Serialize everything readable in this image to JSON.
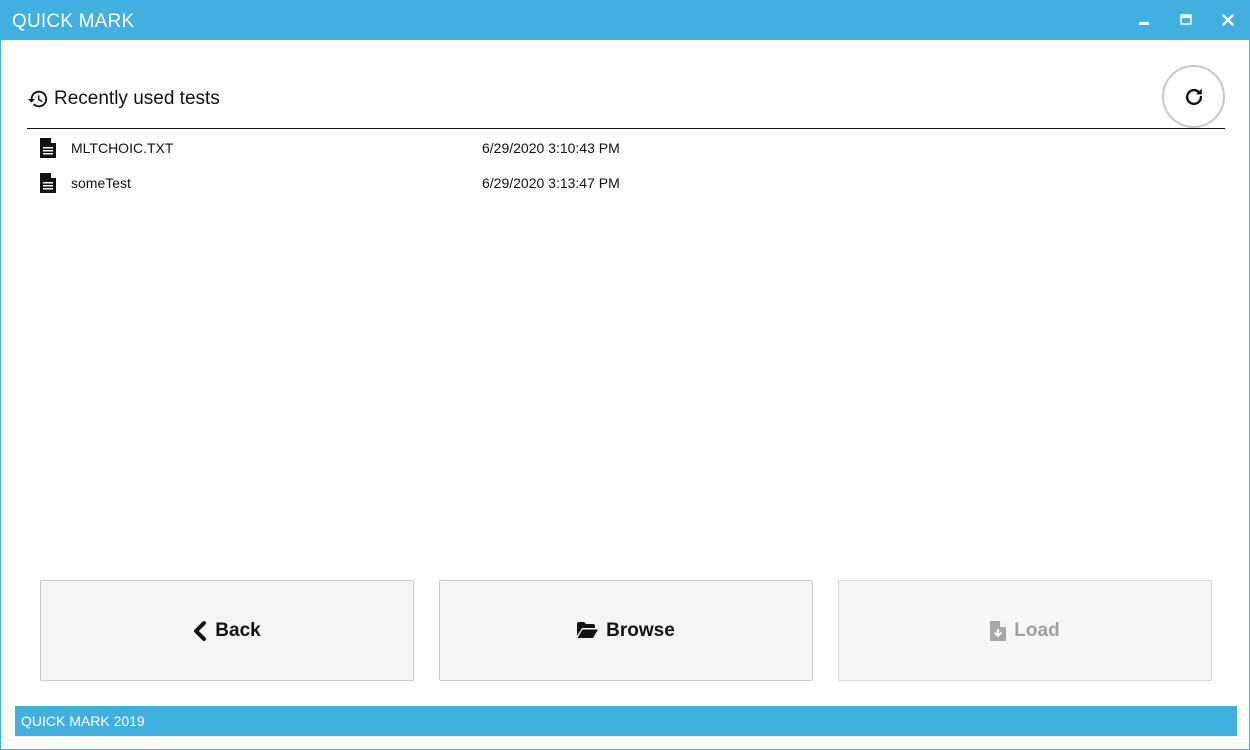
{
  "window": {
    "title": "QUICK MARK",
    "controls": {
      "minimize": "minimize-icon",
      "maximize": "maximize-icon",
      "close": "close-icon"
    }
  },
  "section": {
    "icon": "history-icon",
    "title": "Recently used tests",
    "refresh_icon": "refresh-icon"
  },
  "files": [
    {
      "icon": "file-icon",
      "name": "MLTCHOIC.TXT",
      "date": "6/29/2020 3:10:43 PM"
    },
    {
      "icon": "file-icon",
      "name": "someTest",
      "date": "6/29/2020 3:13:47 PM"
    }
  ],
  "buttons": {
    "back": {
      "label": "Back",
      "icon": "chevron-left-icon"
    },
    "browse": {
      "label": "Browse",
      "icon": "folder-open-icon"
    },
    "load": {
      "label": "Load",
      "icon": "file-download-icon",
      "disabled": true
    }
  },
  "status": {
    "text": "QUICK MARK 2019"
  },
  "colors": {
    "accent": "#41b0e1",
    "button_bg": "#f5f5f5",
    "disabled_text": "#a0a0a0"
  }
}
